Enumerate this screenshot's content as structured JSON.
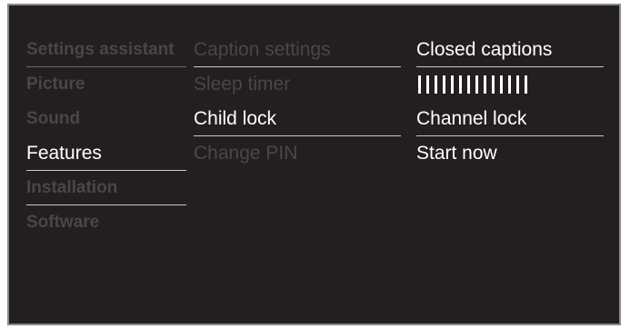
{
  "menu": {
    "categories": [
      {
        "label": "Settings assistant"
      },
      {
        "label": "Picture"
      },
      {
        "label": "Sound"
      },
      {
        "label": "Features"
      },
      {
        "label": "Installation"
      },
      {
        "label": "Software"
      }
    ],
    "features_items": [
      {
        "label": "Caption settings"
      },
      {
        "label": "Sleep timer"
      },
      {
        "label": "Child lock"
      },
      {
        "label": "Change PIN"
      }
    ],
    "child_lock_items": [
      {
        "label": "Closed captions"
      },
      {
        "label": "Channel lock"
      },
      {
        "label": "Start now"
      }
    ],
    "slider": {
      "filled_ticks": 14
    }
  }
}
